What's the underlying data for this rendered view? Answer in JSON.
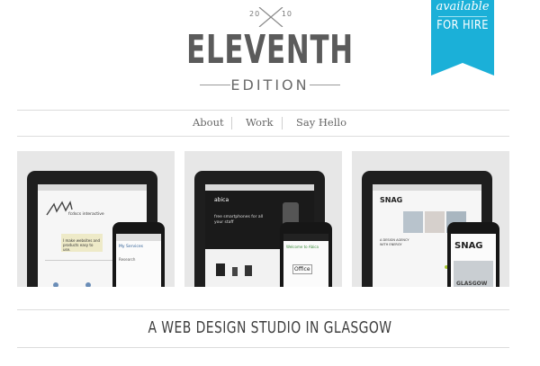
{
  "logo": {
    "year_left": "20",
    "year_right": "10",
    "title": "ELEVENTH",
    "subtitle": "EDITION"
  },
  "ribbon": {
    "line1": "available",
    "line2": "FOR HIRE",
    "color": "#1bb0d8"
  },
  "nav": {
    "items": [
      "About",
      "Work",
      "Say Hello"
    ]
  },
  "portfolio": [
    {
      "site_name": "fcdscs interactive",
      "headline": "I make websites and products easy to use.",
      "phone_heading": "My Services",
      "phone_sub": "Research"
    },
    {
      "site_name": "abica",
      "headline": "free smartphones for all your staff",
      "phone_heading": "Welcome to Abica",
      "phone_sub": "Office"
    },
    {
      "site_name": "SNAG",
      "headline": "A DESIGN AGENCY WITH ENERGY",
      "phone_heading": "SNAG",
      "phone_sub": "GLASGOW"
    }
  ],
  "tagline": "A WEB DESIGN STUDIO IN GLASGOW"
}
